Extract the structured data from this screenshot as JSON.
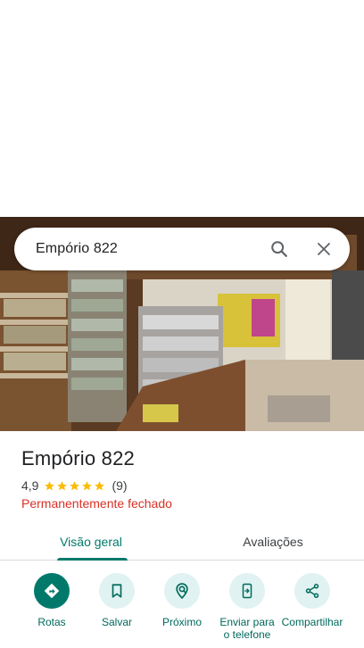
{
  "search": {
    "query": "Empório 822",
    "search_icon": "search-icon",
    "close_icon": "close-icon"
  },
  "place": {
    "name": "Empório 822",
    "rating": "4,9",
    "stars": 5,
    "review_count": "(9)",
    "status": "Permanentemente fechado"
  },
  "tabs": [
    {
      "label": "Visão geral",
      "active": true
    },
    {
      "label": "Avaliações",
      "active": false
    }
  ],
  "actions": [
    {
      "label": "Rotas",
      "icon": "directions-icon"
    },
    {
      "label": "Salvar",
      "icon": "bookmark-icon"
    },
    {
      "label": "Próximo",
      "icon": "nearby-icon"
    },
    {
      "label": "Enviar para o telefone",
      "icon": "send-to-phone-icon"
    },
    {
      "label": "Compartilhar",
      "icon": "share-icon"
    }
  ],
  "colors": {
    "accent": "#00796b",
    "action_bg": "#e0f2f1",
    "closed_red": "#d93025",
    "star": "#fbbc04"
  }
}
